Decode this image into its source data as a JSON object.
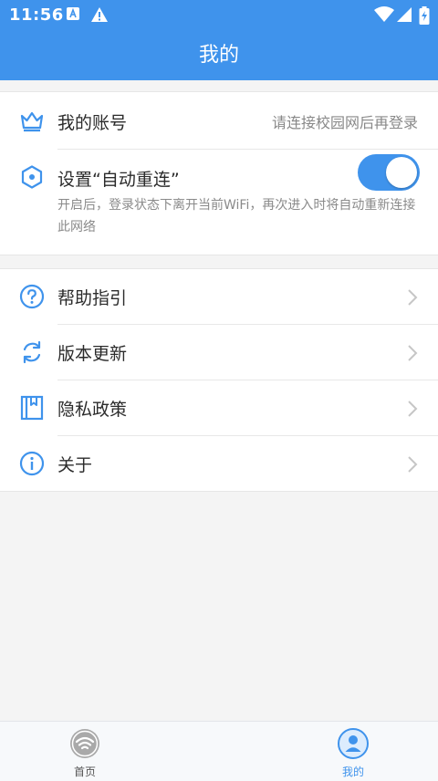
{
  "status": {
    "time": "11:56",
    "icons": [
      "a-notification-icon",
      "warning-icon",
      "wifi-signal-icon",
      "cellular-signal-icon",
      "battery-charging-icon"
    ]
  },
  "header": {
    "title": "我的"
  },
  "account_card": {
    "account": {
      "label": "我的账号",
      "hint": "请连接校园网后再登录",
      "icon": "crown-icon"
    },
    "reconnect": {
      "label": "设置“自动重连”",
      "description": "开启后，登录状态下离开当前WiFi，再次进入时将自动重新连接此网络",
      "enabled": true,
      "icon": "hexagon-settings-icon"
    }
  },
  "menu": {
    "items": [
      {
        "label": "帮助指引",
        "icon": "help-icon"
      },
      {
        "label": "版本更新",
        "icon": "refresh-icon"
      },
      {
        "label": "隐私政策",
        "icon": "privacy-book-icon"
      },
      {
        "label": "关于",
        "icon": "info-icon"
      }
    ]
  },
  "tabbar": {
    "tabs": [
      {
        "label": "首页",
        "icon": "wifi-home-icon",
        "active": false
      },
      {
        "label": "我的",
        "icon": "user-icon",
        "active": true
      }
    ]
  },
  "colors": {
    "accent": "#3f93ec",
    "inactive_tab": "#555555",
    "background": "#f4f4f4"
  }
}
